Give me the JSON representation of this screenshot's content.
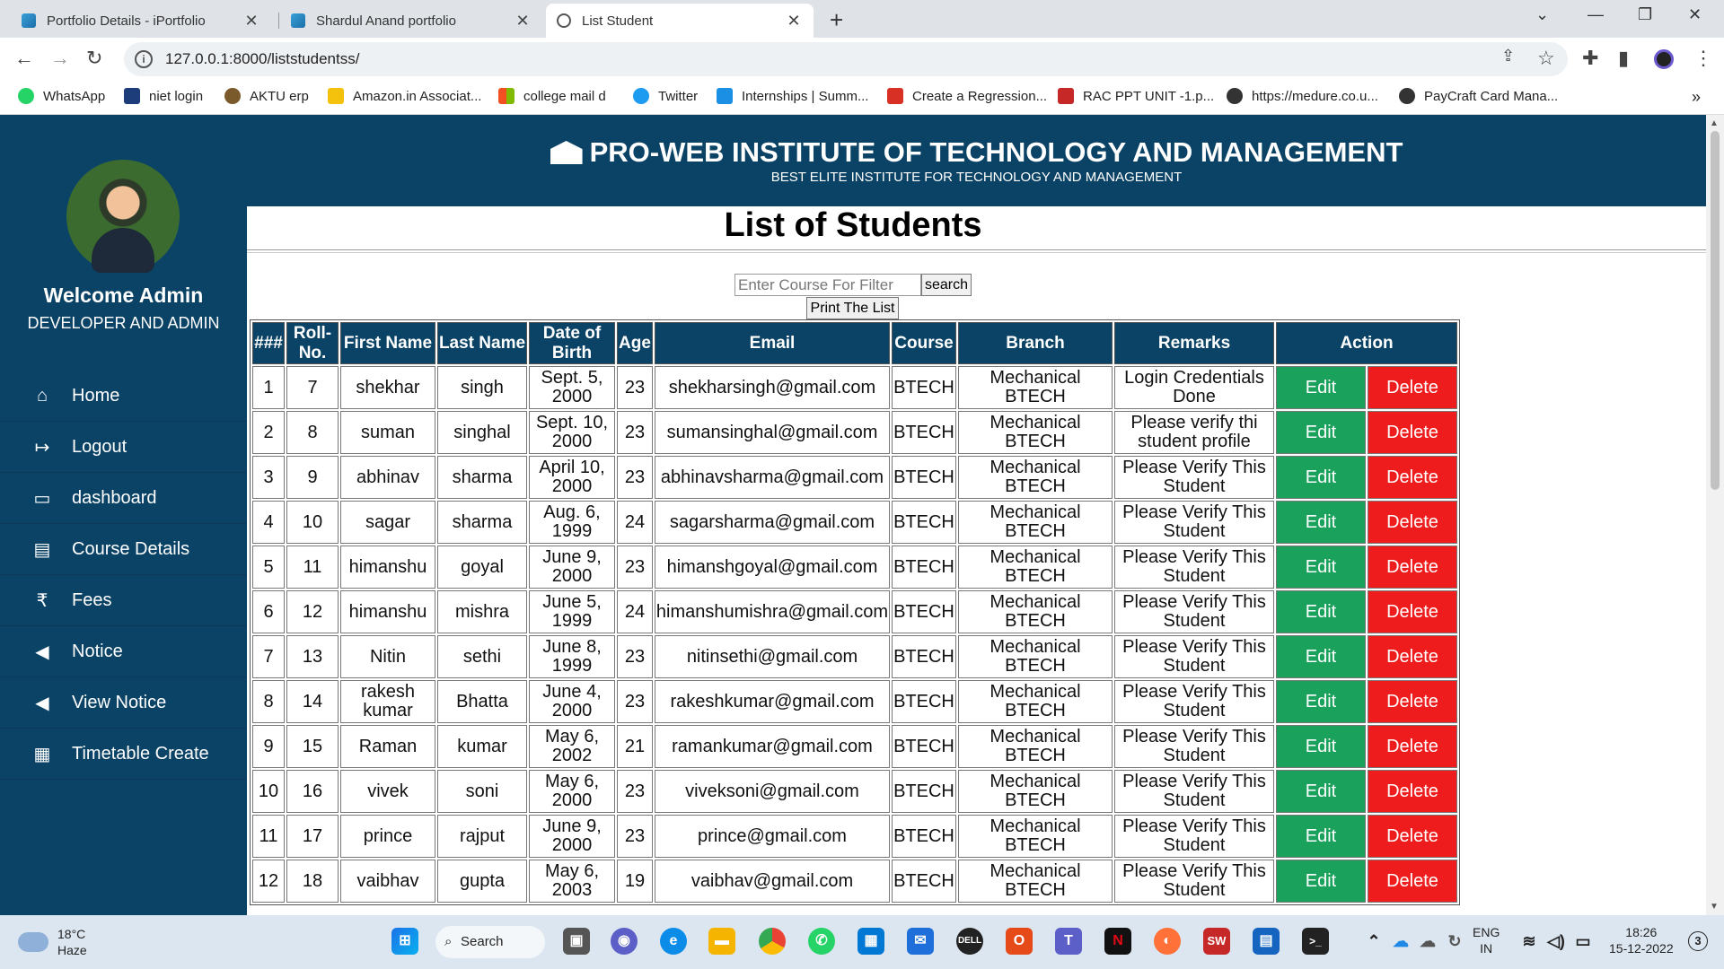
{
  "browser": {
    "tabs": [
      {
        "title": "Portfolio Details - iPortfolio",
        "active": false
      },
      {
        "title": "Shardul Anand portfolio",
        "active": false
      },
      {
        "title": "List Student",
        "active": true
      }
    ],
    "url": "127.0.0.1:8000/liststudentss/",
    "bookmarks": [
      {
        "label": "WhatsApp",
        "color": "#25d366"
      },
      {
        "label": "niet login",
        "color": "#1c3d7a"
      },
      {
        "label": "AKTU erp",
        "color": "#7a5a2a"
      },
      {
        "label": "Amazon.in Associat...",
        "color": "#f4c20d"
      },
      {
        "label": "college mail d",
        "color": "#e94235"
      },
      {
        "label": "Twitter",
        "color": "#1d9bf0"
      },
      {
        "label": "Internships | Summ...",
        "color": "#1a8fe3"
      },
      {
        "label": "Create a Regression...",
        "color": "#d93025"
      },
      {
        "label": "RAC PPT UNIT -1.p...",
        "color": "#c62828"
      },
      {
        "label": "https://medure.co.u...",
        "color": "#333333"
      },
      {
        "label": "PayCraft Card Mana...",
        "color": "#333333"
      }
    ]
  },
  "sidebar": {
    "welcome": "Welcome Admin",
    "role": "DEVELOPER AND ADMIN",
    "items": [
      {
        "label": "Home",
        "icon": "home-icon",
        "glyph": "⌂"
      },
      {
        "label": "Logout",
        "icon": "logout-icon",
        "glyph": "↦"
      },
      {
        "label": "dashboard",
        "icon": "monitor-icon",
        "glyph": "▭"
      },
      {
        "label": "Course Details",
        "icon": "book-icon",
        "glyph": "▤"
      },
      {
        "label": "Fees",
        "icon": "rupee-icon",
        "glyph": "₹"
      },
      {
        "label": "Notice",
        "icon": "megaphone-icon",
        "glyph": "◀"
      },
      {
        "label": "View Notice",
        "icon": "megaphone-icon",
        "glyph": "◀"
      },
      {
        "label": "Timetable Create",
        "icon": "calendar-icon",
        "glyph": "▦"
      }
    ]
  },
  "header": {
    "title": "PRO-WEB INSTITUTE OF TECHNOLOGY AND MANAGEMENT",
    "subtitle": "BEST ELITE INSTITUTE FOR TECHNOLOGY AND MANAGEMENT"
  },
  "main": {
    "title": "List of Students",
    "filter_placeholder": "Enter Course For Filter",
    "search_label": "search",
    "print_label": "Print The List",
    "edit_label": "Edit",
    "delete_label": "Delete",
    "columns": [
      "###",
      "Roll-No.",
      "First Name",
      "Last Name",
      "Date of Birth",
      "Age",
      "Email",
      "Course",
      "Branch",
      "Remarks",
      "Action"
    ],
    "rows": [
      [
        "1",
        "7",
        "shekhar",
        "singh",
        "Sept. 5, 2000",
        "23",
        "shekharsingh@gmail.com",
        "BTECH",
        "Mechanical BTECH",
        "Login Credentials Done"
      ],
      [
        "2",
        "8",
        "suman",
        "singhal",
        "Sept. 10, 2000",
        "23",
        "sumansinghal@gmail.com",
        "BTECH",
        "Mechanical BTECH",
        "Please verify thi student profile"
      ],
      [
        "3",
        "9",
        "abhinav",
        "sharma",
        "April 10, 2000",
        "23",
        "abhinavsharma@gmail.com",
        "BTECH",
        "Mechanical BTECH",
        "Please Verify This Student"
      ],
      [
        "4",
        "10",
        "sagar",
        "sharma",
        "Aug. 6, 1999",
        "24",
        "sagarsharma@gmail.com",
        "BTECH",
        "Mechanical BTECH",
        "Please Verify This Student"
      ],
      [
        "5",
        "11",
        "himanshu",
        "goyal",
        "June 9, 2000",
        "23",
        "himanshgoyal@gmail.com",
        "BTECH",
        "Mechanical BTECH",
        "Please Verify This Student"
      ],
      [
        "6",
        "12",
        "himanshu",
        "mishra",
        "June 5, 1999",
        "24",
        "himanshumishra@gmail.com",
        "BTECH",
        "Mechanical BTECH",
        "Please Verify This Student"
      ],
      [
        "7",
        "13",
        "Nitin",
        "sethi",
        "June 8, 1999",
        "23",
        "nitinsethi@gmail.com",
        "BTECH",
        "Mechanical BTECH",
        "Please Verify This Student"
      ],
      [
        "8",
        "14",
        "rakesh kumar",
        "Bhatta",
        "June 4, 2000",
        "23",
        "rakeshkumar@gmail.com",
        "BTECH",
        "Mechanical BTECH",
        "Please Verify This Student"
      ],
      [
        "9",
        "15",
        "Raman",
        "kumar",
        "May 6, 2002",
        "21",
        "ramankumar@gmail.com",
        "BTECH",
        "Mechanical BTECH",
        "Please Verify This Student"
      ],
      [
        "10",
        "16",
        "vivek",
        "soni",
        "May 6, 2000",
        "23",
        "viveksoni@gmail.com",
        "BTECH",
        "Mechanical BTECH",
        "Please Verify This Student"
      ],
      [
        "11",
        "17",
        "prince",
        "rajput",
        "June 9, 2000",
        "23",
        "prince@gmail.com",
        "BTECH",
        "Mechanical BTECH",
        "Please Verify This Student"
      ],
      [
        "12",
        "18",
        "vaibhav",
        "gupta",
        "May 6, 2003",
        "19",
        "vaibhav@gmail.com",
        "BTECH",
        "Mechanical BTECH",
        "Please Verify This Student"
      ]
    ]
  },
  "taskbar": {
    "temp": "18°C",
    "weather": "Haze",
    "search_label": "Search",
    "lang": "ENG",
    "region": "IN",
    "time": "18:26",
    "date": "15-12-2022",
    "notification_count": "3"
  }
}
